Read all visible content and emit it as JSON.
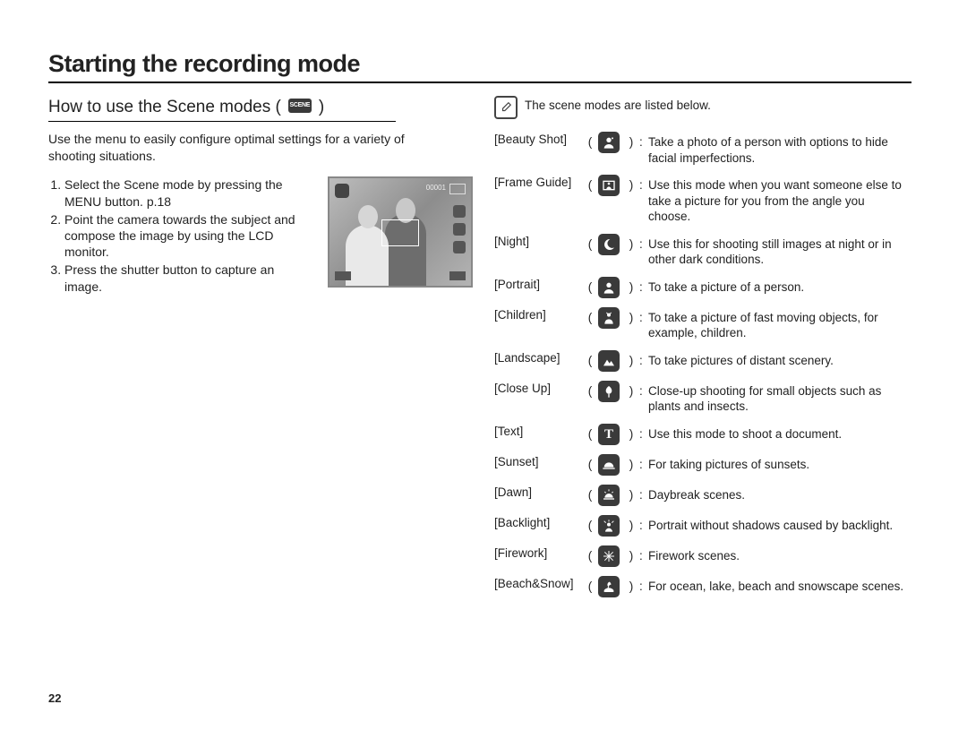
{
  "page_number": "22",
  "title": "Starting the recording mode",
  "left": {
    "subhead": "How to use the Scene modes (",
    "subhead_close": " )",
    "scene_chip": "SCENE",
    "intro": "Use the menu to easily configure optimal settings for a variety of shooting situations.",
    "steps": [
      "Select the Scene mode by pressing the MENU button. p.18",
      "Point the camera towards the subject and compose the image by using the LCD monitor.",
      "Press the shutter button to capture an image."
    ],
    "lcd": {
      "counter": "00001"
    }
  },
  "right": {
    "note_text": "The scene modes are listed below.",
    "scenes": [
      {
        "name": "[Beauty Shot]",
        "icon": "beauty",
        "desc": "Take a photo of a person with options to hide facial imperfections."
      },
      {
        "name": "[Frame Guide]",
        "icon": "frame",
        "desc": "Use this mode when you want someone else to take a picture for you from the angle you choose."
      },
      {
        "name": "[Night]",
        "icon": "night",
        "desc": "Use this for shooting still images at night or in other dark conditions."
      },
      {
        "name": "[Portrait]",
        "icon": "portrait",
        "desc": "To take a picture of a person."
      },
      {
        "name": "[Children]",
        "icon": "children",
        "desc": "To take a picture of fast moving objects, for example, children."
      },
      {
        "name": "[Landscape]",
        "icon": "landscape",
        "desc": "To take pictures of distant scenery."
      },
      {
        "name": "[Close Up]",
        "icon": "closeup",
        "desc": "Close-up shooting for small objects such as plants and insects."
      },
      {
        "name": "[Text]",
        "icon": "text",
        "desc": "Use this mode to shoot a document."
      },
      {
        "name": "[Sunset]",
        "icon": "sunset",
        "desc": "For taking pictures of sunsets."
      },
      {
        "name": "[Dawn]",
        "icon": "dawn",
        "desc": "Daybreak scenes."
      },
      {
        "name": "[Backlight]",
        "icon": "backlight",
        "desc": "Portrait without shadows caused by backlight."
      },
      {
        "name": "[Firework]",
        "icon": "firework",
        "desc": "Firework scenes."
      },
      {
        "name": "[Beach&Snow]",
        "icon": "beach",
        "desc": "For ocean, lake, beach and snowscape scenes."
      }
    ]
  }
}
